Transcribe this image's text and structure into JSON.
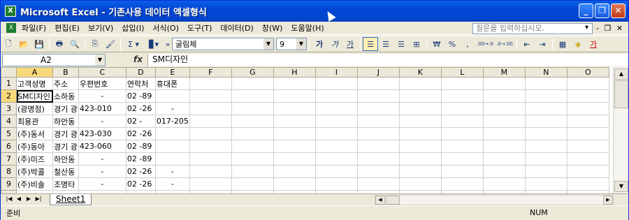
{
  "window": {
    "title": "Microsoft Excel - 기존사용 데이터 엑셀형식",
    "app_icon": "X",
    "minimize_icon": "_",
    "restore_icon": "❐",
    "close_icon": "✕"
  },
  "menubar": {
    "items": [
      "파일(F)",
      "편집(E)",
      "보기(V)",
      "삽입(I)",
      "서식(O)",
      "도구(T)",
      "데이터(D)",
      "창(W)",
      "도움말(H)"
    ],
    "help_placeholder": "질문을 입력하십시오.",
    "help_arrow": "▾",
    "doc_controls": "- ❐ ✕"
  },
  "toolbar": {
    "font_name": "굴림체",
    "font_size": "9",
    "sigma": "Σ ▾",
    "chart": "▊▾",
    "more": "»",
    "bold": "가",
    "italic": "가",
    "underline": "가",
    "currency": "₩",
    "percent": "%",
    "comma": ",",
    "inc_decimal": ".00→.0",
    "dec_decimal": ".0→.00",
    "font_color_label": "가",
    "combo_arrow": "▼"
  },
  "formula": {
    "name_box": "A2",
    "fx": "fx",
    "content": "SM디자인"
  },
  "sheet": {
    "column_headers": [
      "A",
      "B",
      "C",
      "D",
      "E",
      "F",
      "G",
      "H",
      "I",
      "J",
      "K",
      "L",
      "M",
      "N",
      "O"
    ],
    "selected_col": "A",
    "selected_row": "2",
    "rows": [
      {
        "n": "1",
        "cells": [
          "고객성명",
          "주소",
          "우편번호",
          "연락처",
          "휴대폰",
          "",
          "",
          "",
          "",
          "",
          "",
          "",
          "",
          "",
          ""
        ]
      },
      {
        "n": "2",
        "cells": [
          "SM디자인",
          "소하동",
          "-",
          "02 -89",
          "",
          "",
          "",
          "",
          "",
          "",
          "",
          "",
          "",
          "",
          ""
        ]
      },
      {
        "n": "3",
        "cells": [
          "(광명점)",
          "경기 광",
          "423-010",
          "02 -26",
          "-",
          "",
          "",
          "",
          "",
          "",
          "",
          "",
          "",
          "",
          ""
        ]
      },
      {
        "n": "4",
        "cells": [
          "최용관",
          "하안동",
          "-",
          "02 -",
          "017-205",
          "",
          "",
          "",
          "",
          "",
          "",
          "",
          "",
          "",
          ""
        ]
      },
      {
        "n": "5",
        "cells": [
          "(주)동서",
          "경기 광",
          "423-030",
          "02 -26",
          "",
          "",
          "",
          "",
          "",
          "",
          "",
          "",
          "",
          "",
          ""
        ]
      },
      {
        "n": "6",
        "cells": [
          "(주)동아",
          "경기 광",
          "423-060",
          "02 -89",
          "",
          "",
          "",
          "",
          "",
          "",
          "",
          "",
          "",
          "",
          ""
        ]
      },
      {
        "n": "7",
        "cells": [
          "(주)미즈",
          "하안동",
          "-",
          "02 -89",
          "",
          "",
          "",
          "",
          "",
          "",
          "",
          "",
          "",
          "",
          ""
        ]
      },
      {
        "n": "8",
        "cells": [
          "(주)박콜",
          "철산동",
          "-",
          "02 -26",
          "-",
          "",
          "",
          "",
          "",
          "",
          "",
          "",
          "",
          "",
          ""
        ]
      },
      {
        "n": "9",
        "cells": [
          "(주)비솔",
          "조명타",
          "-",
          "02 -26",
          "-",
          "",
          "",
          "",
          "",
          "",
          "",
          "",
          "",
          "",
          ""
        ]
      },
      {
        "n": "10",
        "cells": [
          "(주)삼학",
          "경기 광",
          "423-060",
          "02 -89",
          "",
          "",
          "",
          "",
          "",
          "",
          "",
          "",
          "",
          "",
          ""
        ]
      }
    ]
  },
  "sheetbar": {
    "nav": [
      "|◀",
      "◀",
      "▶",
      "▶|"
    ],
    "tab": "Sheet1",
    "scroll_left": "◀",
    "scroll_right": "▶"
  },
  "vscroll": {
    "up": "▲",
    "down": "▼"
  },
  "status": {
    "ready": "준비",
    "num": "NUM"
  }
}
